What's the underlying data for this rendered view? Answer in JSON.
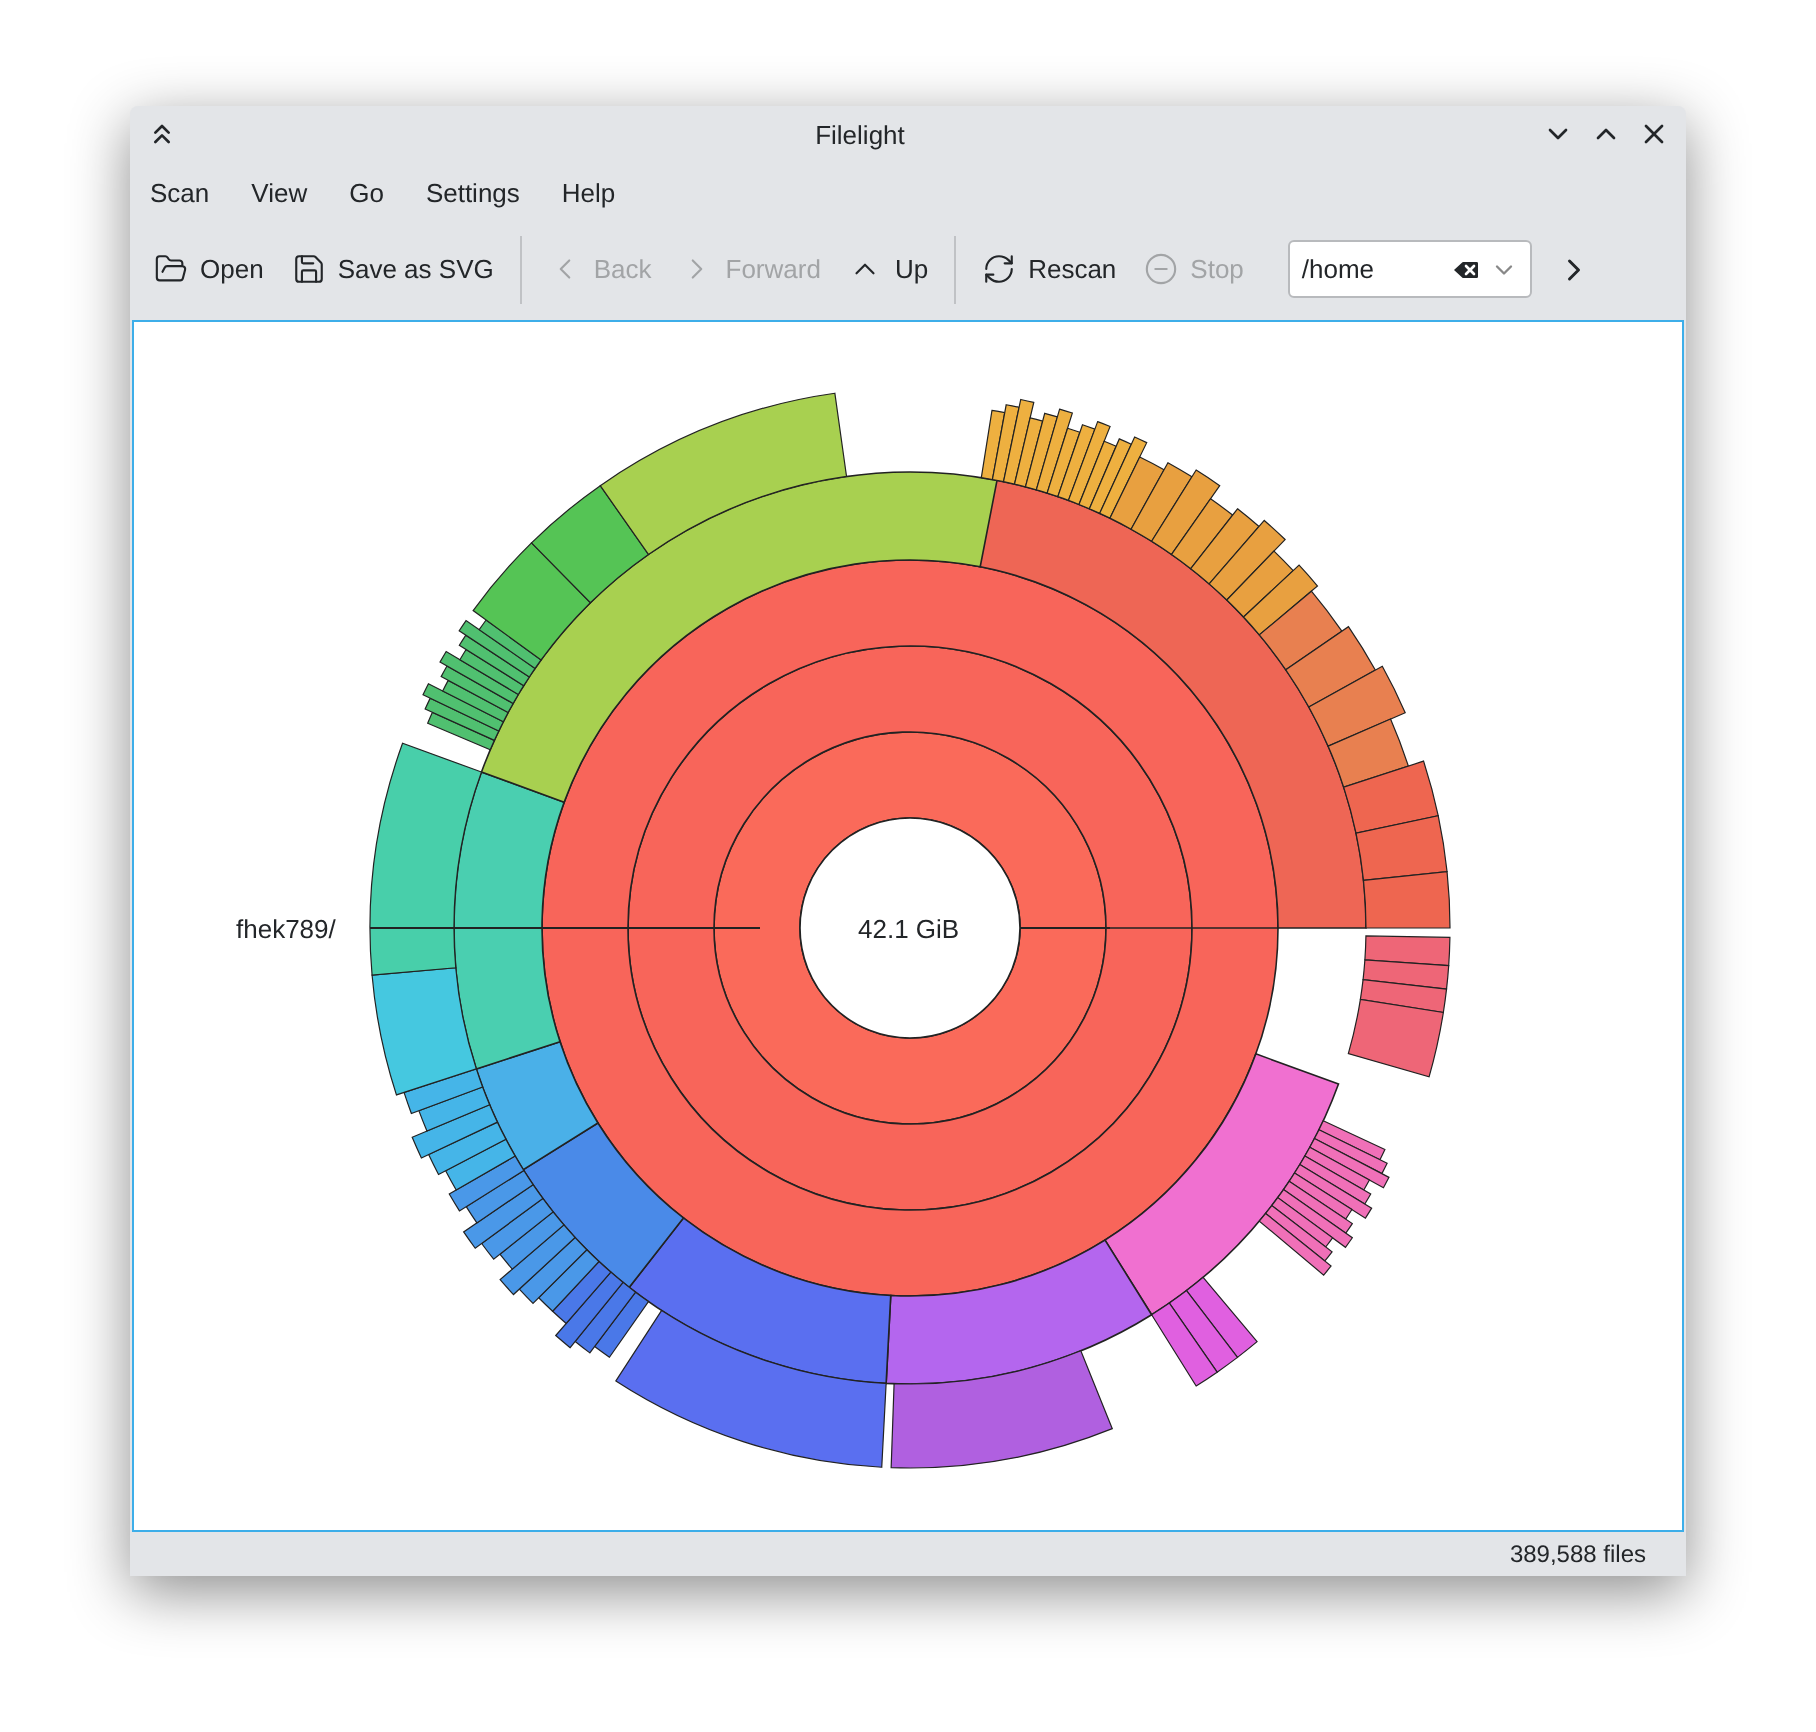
{
  "window": {
    "title": "Filelight"
  },
  "menu": [
    "Scan",
    "View",
    "Go",
    "Settings",
    "Help"
  ],
  "toolbar": [
    [
      {
        "label": "Open",
        "disabled": false
      },
      {
        "label": "Save as SVG",
        "disabled": false
      }
    ],
    [
      {
        "label": "Back",
        "disabled": true
      },
      {
        "label": "Forward",
        "disabled": true
      },
      {
        "label": "Up",
        "disabled": false
      }
    ],
    [
      {
        "label": "Rescan",
        "disabled": false
      },
      {
        "label": "Stop",
        "disabled": true
      }
    ]
  ],
  "location": {
    "value": "/home"
  },
  "map": {
    "center_label": "42.1 GiB",
    "hover_label": "fhek789/"
  },
  "status_bar": "389,588 files"
}
